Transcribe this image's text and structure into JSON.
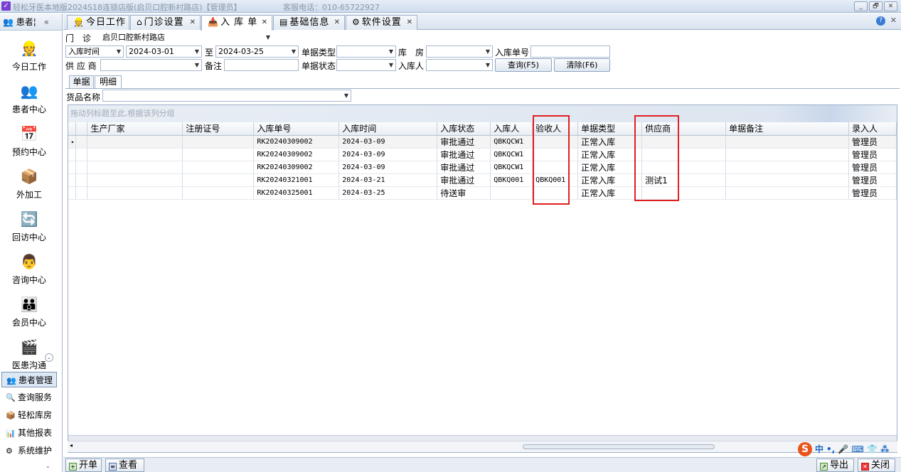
{
  "window": {
    "title": "轻松牙医本地版2024S18连锁店版(启贝口腔新村路店)【管理员】",
    "hotline": "客服电话：010-65722927",
    "controls": [
      "_",
      "🗗",
      "✕"
    ]
  },
  "sidebar": {
    "header": "患者¦",
    "collapse": "«",
    "big_items": [
      {
        "label": "今日工作",
        "icon": "worker-icon",
        "glyph": "👷"
      },
      {
        "label": "患者中心",
        "icon": "people-search-icon",
        "glyph": "👥"
      },
      {
        "label": "预约中心",
        "icon": "calendar-icon",
        "glyph": "📅"
      },
      {
        "label": "外加工",
        "icon": "cubes-icon",
        "glyph": "📦"
      },
      {
        "label": "回访中心",
        "icon": "refresh-icon",
        "glyph": "🔄"
      },
      {
        "label": "咨询中心",
        "icon": "consultant-icon",
        "glyph": "👨"
      },
      {
        "label": "会员中心",
        "icon": "members-icon",
        "glyph": "👪"
      },
      {
        "label": "医患沟通",
        "icon": "film-icon",
        "glyph": "🎬"
      }
    ],
    "small_items": [
      {
        "label": "患者管理",
        "icon": "patients-icon",
        "glyph": "👥"
      },
      {
        "label": "查询服务",
        "icon": "query-icon",
        "glyph": "🔍"
      },
      {
        "label": "轻松库房",
        "icon": "warehouse-icon",
        "glyph": "📦"
      },
      {
        "label": "其他报表",
        "icon": "report-icon",
        "glyph": "📊"
      },
      {
        "label": "系统维护",
        "icon": "settings-icon",
        "glyph": "⚙"
      }
    ]
  },
  "tabs": [
    {
      "label": "今日工作",
      "icon": "worker-icon",
      "glyph": "👷"
    },
    {
      "label": "门诊设置",
      "icon": "home-icon",
      "glyph": "⌂"
    },
    {
      "label": "入 库 单",
      "icon": "inbound-icon",
      "glyph": "📥"
    },
    {
      "label": "基础信息",
      "icon": "info-icon",
      "glyph": "▤"
    },
    {
      "label": "软件设置",
      "icon": "gear-icon",
      "glyph": "⚙"
    }
  ],
  "filters": {
    "clinic_label": "门　诊",
    "clinic_value": "启贝口腔新村路店",
    "date_field": "入库时间",
    "date_from": "2024-03-01",
    "to_label": "至",
    "date_to": "2024-03-25",
    "doc_type_label": "单据类型",
    "warehouse_label": "库　房",
    "doc_no_label": "入库单号",
    "supplier_label": "供 应 商",
    "remark_label": "备注",
    "doc_status_label": "单据状态",
    "receiver_label": "入库人",
    "query_button": "查询(F5)",
    "clear_button": "清除(F6)"
  },
  "subtabs": [
    "单据",
    "明细"
  ],
  "goods_label": "货品名称",
  "group_hint": "拖动列标题至此,根据该列分组",
  "table": {
    "columns": [
      "生产厂家",
      "注册证号",
      "入库单号",
      "入库时间",
      "入库状态",
      "入库人",
      "验收人",
      "单据类型",
      "供应商",
      "单据备注",
      "录入人"
    ],
    "rows": [
      [
        "",
        "",
        "RK20240309002",
        "2024-03-09",
        "审批通过",
        "QBKQCW1",
        "",
        "正常入库",
        "",
        "",
        "管理员"
      ],
      [
        "",
        "",
        "RK20240309002",
        "2024-03-09",
        "审批通过",
        "QBKQCW1",
        "",
        "正常入库",
        "",
        "",
        "管理员"
      ],
      [
        "",
        "",
        "RK20240309002",
        "2024-03-09",
        "审批通过",
        "QBKQCW1",
        "",
        "正常入库",
        "",
        "",
        "管理员"
      ],
      [
        "",
        "",
        "RK20240321001",
        "2024-03-21",
        "审批通过",
        "QBKQ001",
        "QBKQ001",
        "正常入库",
        "测试1",
        "",
        "管理员"
      ],
      [
        "",
        "",
        "RK20240325001",
        "2024-03-25",
        "待送审",
        "",
        "",
        "正常入库",
        "",
        "",
        "管理员"
      ]
    ],
    "row_indicator": "▸"
  },
  "bottom": {
    "new_button": "开单",
    "view_button": "查看",
    "export_button": "导出",
    "close_button": "关闭"
  },
  "ime": {
    "logo": "S",
    "mode": "中",
    "extras": "•, 🎤 ⌨ 👕 ⁂"
  },
  "help": {
    "glyph": "?",
    "close": "✕"
  },
  "colors": {
    "highlight_box": "#e02020",
    "accent": "#3a7bd5"
  }
}
